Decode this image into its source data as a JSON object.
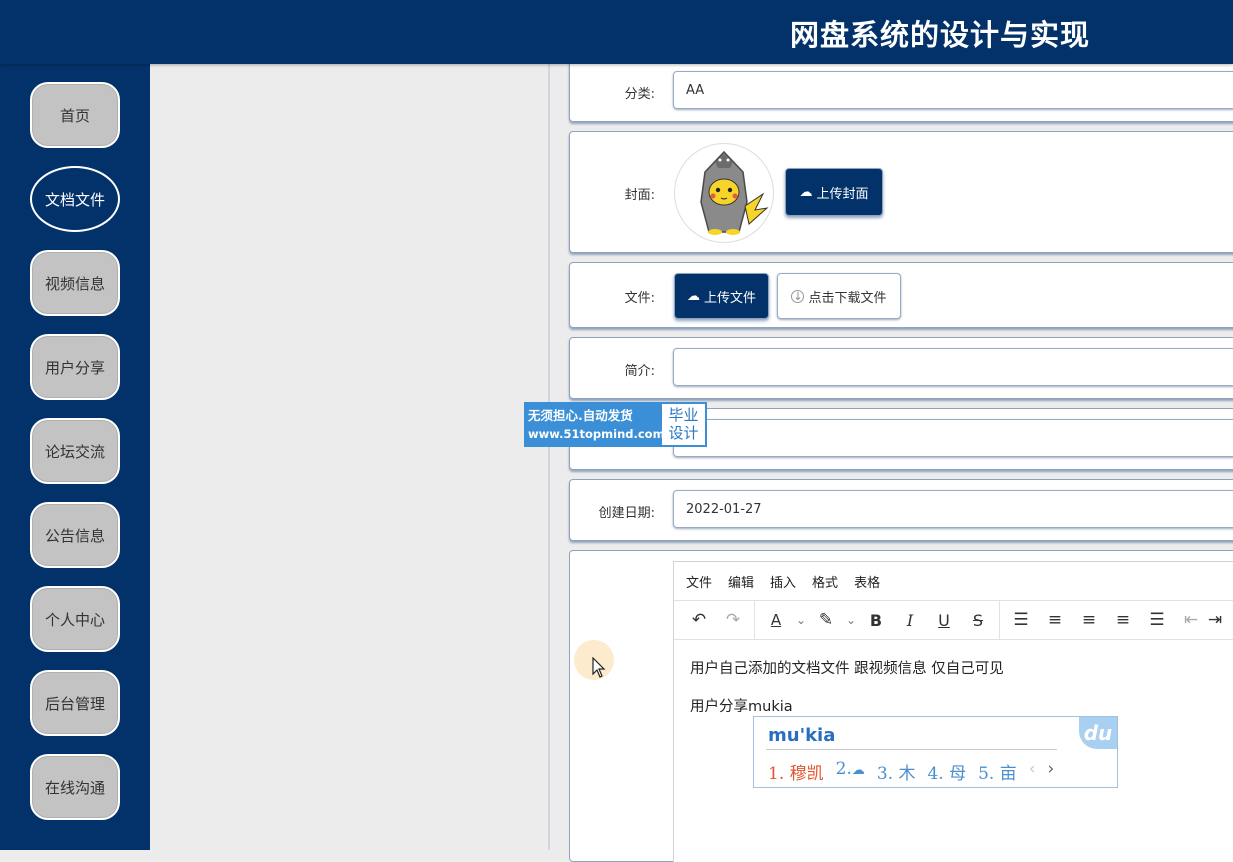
{
  "header": {
    "title": "网盘系统的设计与实现"
  },
  "sidebar": {
    "items": [
      {
        "label": "首页"
      },
      {
        "label": "文档文件"
      },
      {
        "label": "视频信息"
      },
      {
        "label": "用户分享"
      },
      {
        "label": "论坛交流"
      },
      {
        "label": "公告信息"
      },
      {
        "label": "个人中心"
      },
      {
        "label": "后台管理"
      },
      {
        "label": "在线沟通"
      }
    ],
    "active": "文档文件"
  },
  "form": {
    "category": {
      "label": "分类:",
      "value": "AA"
    },
    "cover": {
      "label": "封面:",
      "upload_button": "上传封面"
    },
    "file": {
      "label": "文件:",
      "upload_button": "上传文件",
      "download_button": "点击下载文件"
    },
    "intro": {
      "label": "简介:",
      "value": ""
    },
    "created": {
      "label": "创建日期:",
      "value": "2022-01-27"
    }
  },
  "editor": {
    "menus": [
      "文件",
      "编辑",
      "插入",
      "格式",
      "表格"
    ],
    "lines": [
      "用户自己添加的文档文件  跟视频信息  仅自己可见",
      "用户分享mukia"
    ]
  },
  "ime": {
    "composition": "mu'kia",
    "candidates": [
      "1. 穆凯",
      "2.",
      "3. 木",
      "4. 母",
      "5. 亩"
    ],
    "logo": "du"
  },
  "watermark": {
    "line1": "无须担心.自动发货",
    "line2": "www.51topmind.com",
    "side_line1": "毕业",
    "side_line2": "设计"
  },
  "colors": {
    "primary": "#03326b",
    "background": "#ececec",
    "ime_accent": "#e3542e"
  }
}
